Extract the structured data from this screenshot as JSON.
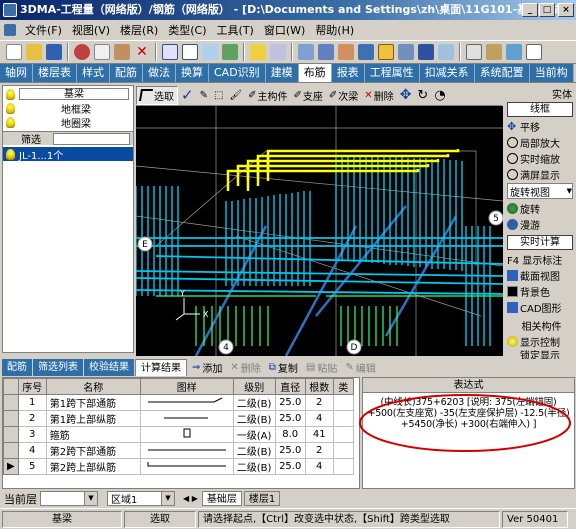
{
  "window": {
    "title": "3DMA-工程量（网络版）/钢筋（网络版） - [D:\\Documents and Settings\\zh\\桌面\\11G101-基础测试...",
    "minimize": "_",
    "maximize": "□",
    "close": "×"
  },
  "menu": [
    "文件(F)",
    "视图(V)",
    "楼层(R)",
    "类型(C)",
    "工具(T)",
    "窗口(W)",
    "帮助(H)"
  ],
  "tabs": [
    "轴网",
    "楼层表",
    "样式",
    "配筋",
    "做法",
    "换算",
    "CAD识别",
    "建模",
    "布筋",
    "报表",
    "工程属性",
    "扣减关系",
    "系统配置",
    "当前构"
  ],
  "active_tab": "布筋",
  "left_panel": {
    "items": [
      "基梁",
      "地框梁",
      "地圈梁"
    ],
    "filter_label": "筛选",
    "tree_item": "JL-1...1个"
  },
  "view_toolbar": {
    "select": "选取",
    "main_member": "主构件",
    "support": "支座",
    "secondary_beam": "次梁",
    "delete": "删除"
  },
  "right_panel": {
    "solid": "实体",
    "wireframe": "线框",
    "pan": "平移",
    "zoom_region": "局部放大",
    "realtime_zoom": "实时缩放",
    "fit_display": "满屏显示",
    "rotate_view": "旋转视图",
    "rotate": "旋转",
    "roam": "漫游",
    "realtime_calc": "实时计算",
    "f4_label": "F4  显示标注",
    "section_view": "截面视图",
    "bg_color": "背景色",
    "cad_graphics": "CAD图形",
    "related_members": "相关构件",
    "show_control": "显示控制",
    "lock_display": "锁定显示"
  },
  "bottom_tabs": [
    "配筋",
    "筛选列表",
    "校验结果",
    "计算结果"
  ],
  "active_bottom_tab": "计算结果",
  "bottom_tools": {
    "add": "添加",
    "delete": "删除",
    "copy": "复制",
    "paste": "粘贴",
    "edit": "编辑"
  },
  "table": {
    "columns": [
      "序号",
      "名称",
      "图样",
      "级别",
      "直径",
      "根数",
      "类"
    ],
    "rows": [
      {
        "no": "1",
        "name": "第1跨下部通筋",
        "grade": "二级(B)",
        "dia": "25.0",
        "count": "2"
      },
      {
        "no": "2",
        "name": "第1跨上部纵筋",
        "grade": "二级(B)",
        "dia": "25.0",
        "count": "4"
      },
      {
        "no": "3",
        "name": "箍筋",
        "grade": "一级(A)",
        "dia": "8.0",
        "count": "41"
      },
      {
        "no": "4",
        "name": "第2跨下部通筋",
        "grade": "二级(B)",
        "dia": "25.0",
        "count": "2"
      },
      {
        "no": "5",
        "name": "第2跨上部纵筋",
        "grade": "二级(B)",
        "dia": "25.0",
        "count": "4"
      }
    ]
  },
  "formula": {
    "header": "表达式",
    "text": "(中线长)375+6203 [说明: 375(左端锚固) +500(左支座宽) -35(左支座保护层) -12.5(半径) +5450(净长) +300(右端伸入) ]"
  },
  "floor_bar": {
    "label": "当前层",
    "region": "区域1",
    "floors": [
      "基础层",
      "楼层1"
    ]
  },
  "status": {
    "floor": "基梁",
    "mode": "选取",
    "hint": "请选择起点,【Ctrl】改变选中状态,【Shift】跨类型选取",
    "version": "Ver 50401"
  },
  "viewport_labels": {
    "e": "E",
    "five": "5",
    "four": "4",
    "d": "D",
    "x_axis": "X",
    "y_axis": "Y"
  },
  "colors": {
    "title_start": "#0a246a",
    "tab_blue": "#2f6fa8",
    "rebar_yellow": "#ffff00",
    "rebar_cyan": "#00e0ff",
    "highlight_red": "#d00000"
  }
}
